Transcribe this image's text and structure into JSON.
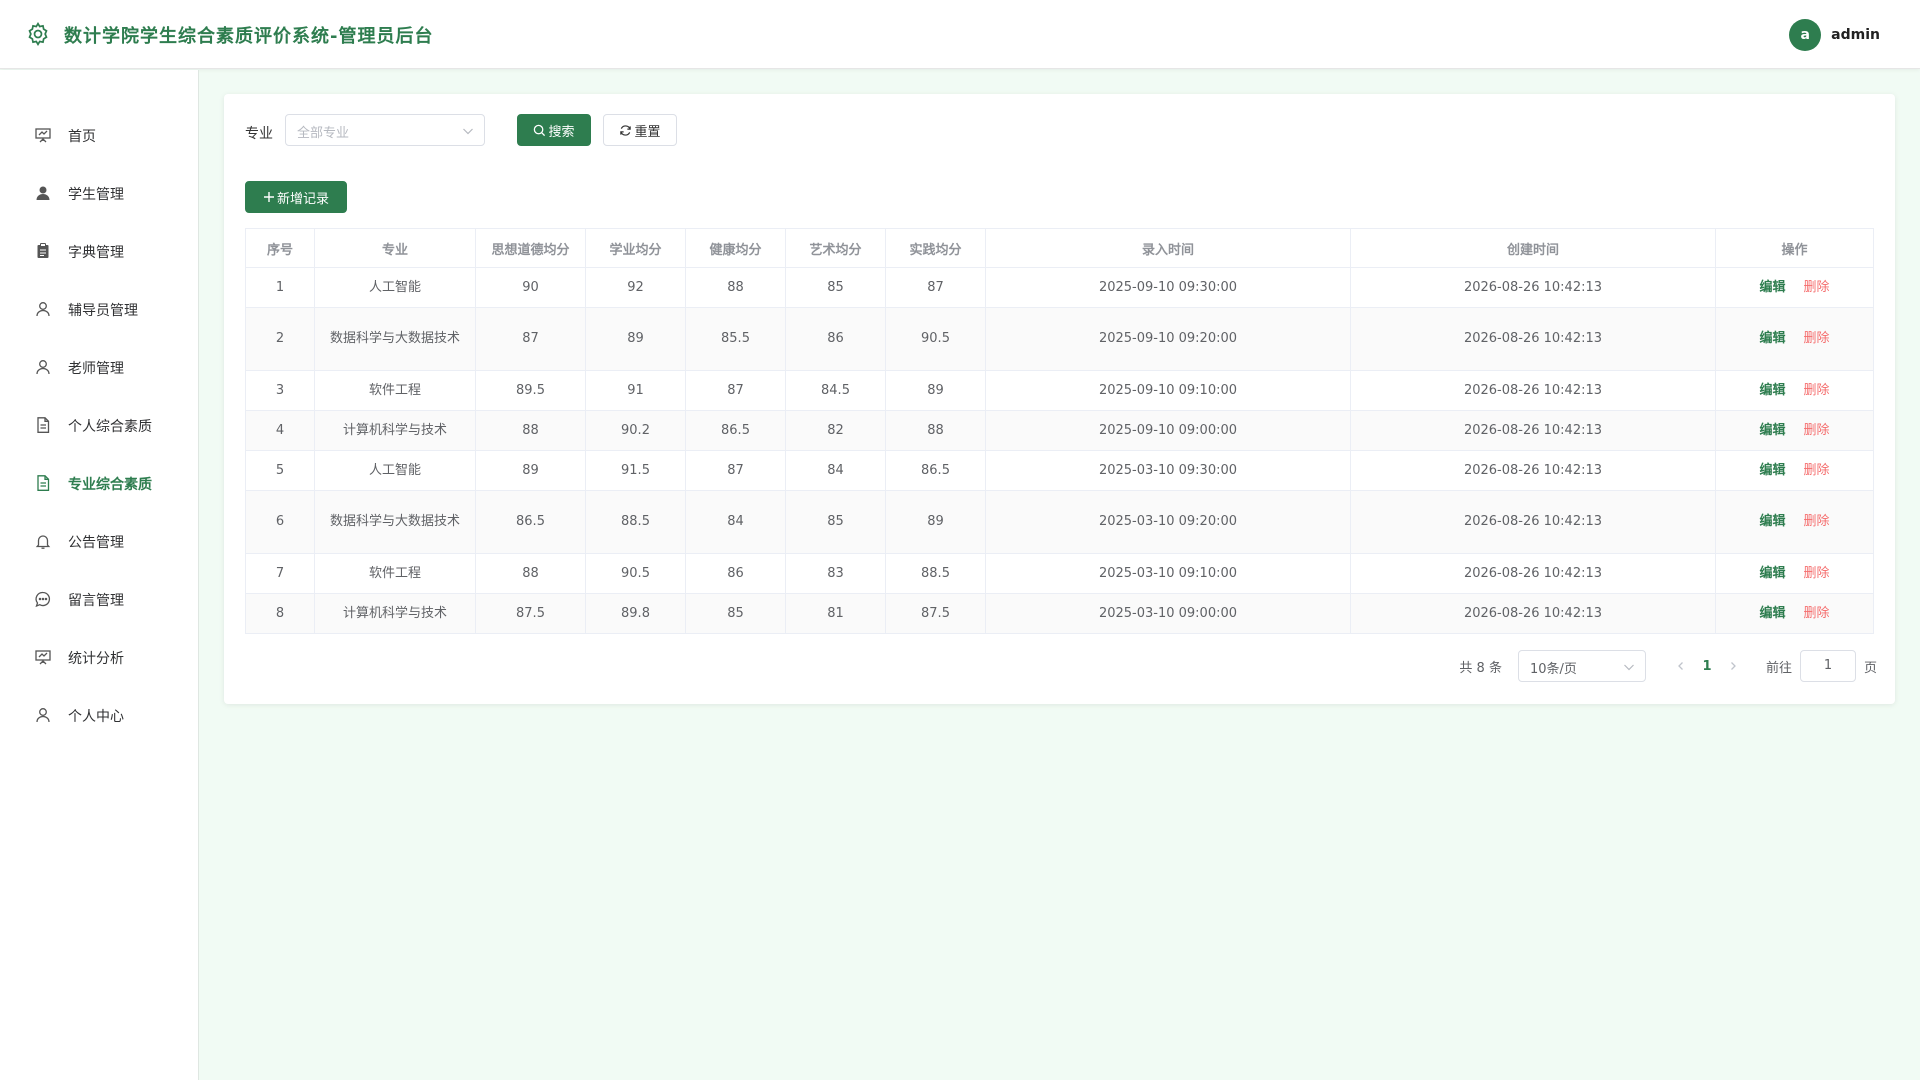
{
  "header": {
    "title": "数计学院学生综合素质评价系统-管理员后台",
    "avatar_letter": "a",
    "username": "admin"
  },
  "sidebar": {
    "items": [
      {
        "label": "首页",
        "icon": "presentation-board-icon",
        "active": false
      },
      {
        "label": "学生管理",
        "icon": "user-filled-icon",
        "active": false
      },
      {
        "label": "字典管理",
        "icon": "clipboard-icon",
        "active": false
      },
      {
        "label": "辅导员管理",
        "icon": "user-outline-icon",
        "active": false
      },
      {
        "label": "老师管理",
        "icon": "user-outline-icon",
        "active": false
      },
      {
        "label": "个人综合素质",
        "icon": "document-icon",
        "active": false
      },
      {
        "label": "专业综合素质",
        "icon": "document-icon",
        "active": true
      },
      {
        "label": "公告管理",
        "icon": "bell-icon",
        "active": false
      },
      {
        "label": "留言管理",
        "icon": "chat-bubble-icon",
        "active": false
      },
      {
        "label": "统计分析",
        "icon": "presentation-board-icon",
        "active": false
      },
      {
        "label": "个人中心",
        "icon": "user-outline-icon",
        "active": false
      }
    ]
  },
  "filter": {
    "label": "专业",
    "placeholder": "全部专业",
    "search_label": "搜索",
    "reset_label": "重置"
  },
  "toolbar": {
    "add_label": "新增记录"
  },
  "table": {
    "columns": [
      "序号",
      "专业",
      "思想道德均分",
      "学业均分",
      "健康均分",
      "艺术均分",
      "实践均分",
      "录入时间",
      "创建时间",
      "操作"
    ],
    "rows": [
      [
        "1",
        "人工智能",
        "90",
        "92",
        "88",
        "85",
        "87",
        "2025-09-10 09:30:00",
        "2026-08-26 10:42:13"
      ],
      [
        "2",
        "数据科学与大数据技术",
        "87",
        "89",
        "85.5",
        "86",
        "90.5",
        "2025-09-10 09:20:00",
        "2026-08-26 10:42:13"
      ],
      [
        "3",
        "软件工程",
        "89.5",
        "91",
        "87",
        "84.5",
        "89",
        "2025-09-10 09:10:00",
        "2026-08-26 10:42:13"
      ],
      [
        "4",
        "计算机科学与技术",
        "88",
        "90.2",
        "86.5",
        "82",
        "88",
        "2025-09-10 09:00:00",
        "2026-08-26 10:42:13"
      ],
      [
        "5",
        "人工智能",
        "89",
        "91.5",
        "87",
        "84",
        "86.5",
        "2025-03-10 09:30:00",
        "2026-08-26 10:42:13"
      ],
      [
        "6",
        "数据科学与大数据技术",
        "86.5",
        "88.5",
        "84",
        "85",
        "89",
        "2025-03-10 09:20:00",
        "2026-08-26 10:42:13"
      ],
      [
        "7",
        "软件工程",
        "88",
        "90.5",
        "86",
        "83",
        "88.5",
        "2025-03-10 09:10:00",
        "2026-08-26 10:42:13"
      ],
      [
        "8",
        "计算机科学与技术",
        "87.5",
        "89.8",
        "85",
        "81",
        "87.5",
        "2025-03-10 09:00:00",
        "2026-08-26 10:42:13"
      ]
    ],
    "edit_label": "编辑",
    "delete_label": "删除"
  },
  "pagination": {
    "total_text": "共 8 条",
    "page_size": "10条/页",
    "current_page": "1",
    "goto_label": "前往",
    "goto_value": "1",
    "page_unit": "页"
  },
  "colors": {
    "primary": "#2e7d4f",
    "danger": "#f56c6c",
    "background": "#f1fbf4"
  }
}
